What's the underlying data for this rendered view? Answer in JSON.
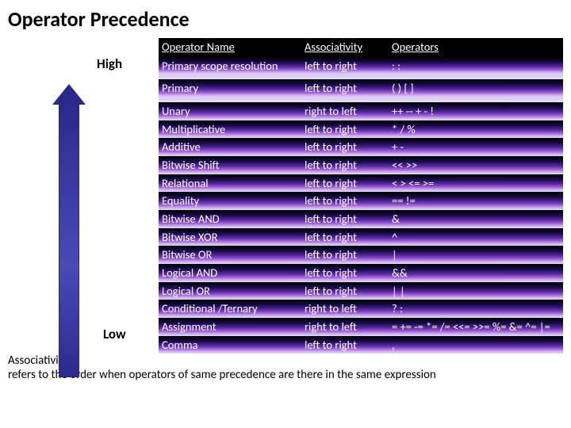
{
  "title": "Operator Precedence",
  "labels": {
    "high": "High",
    "low": "Low"
  },
  "headers": {
    "name": "Operator Name",
    "assoc": "Associativity",
    "ops": "Operators"
  },
  "rows": [
    {
      "name": "Primary scope resolution",
      "assoc": "left to right",
      "ops": ": :",
      "multiline": true
    },
    {
      "gap": true
    },
    {
      "name": "Primary",
      "assoc": "left to right",
      "ops": "( )  [ ]"
    },
    {
      "gap": true
    },
    {
      "name": "Unary",
      "assoc": "right to left",
      "ops": "++  --  +  -  !"
    },
    {
      "name": "Multiplicative",
      "assoc": "left to right",
      "ops": "*  /  %"
    },
    {
      "name": "Additive",
      "assoc": "left to right",
      "ops": "+  -"
    },
    {
      "name": "Bitwise Shift",
      "assoc": "left to right",
      "ops": "<<  >>"
    },
    {
      "name": "Relational",
      "assoc": "left to right",
      "ops": "<  >  <=  >="
    },
    {
      "name": "Equality",
      "assoc": "left to right",
      "ops": "==  !="
    },
    {
      "name": "Bitwise AND",
      "assoc": "left to right",
      "ops": "&"
    },
    {
      "name": "Bitwise XOR",
      "assoc": "left to right",
      "ops": "^"
    },
    {
      "name": "Bitwise OR",
      "assoc": "left to right",
      "ops": "|"
    },
    {
      "name": "Logical AND",
      "assoc": "left to right",
      "ops": "&&"
    },
    {
      "name": "Logical OR",
      "assoc": "left to right",
      "ops": "| |"
    },
    {
      "name": "Conditional /Ternary",
      "assoc": "right to left",
      "ops": "? :"
    },
    {
      "name": "Assignment",
      "assoc": "right to left",
      "ops": "=  +=  -=  *=   /=  <<=  >>=  %=   &=  ^=  |="
    },
    {
      "name": "Comma",
      "assoc": "left to right",
      "ops": ","
    }
  ],
  "footer": {
    "line1": "Associativity",
    "line2": "refers to the order when operators of same precedence are there in the same expression"
  }
}
